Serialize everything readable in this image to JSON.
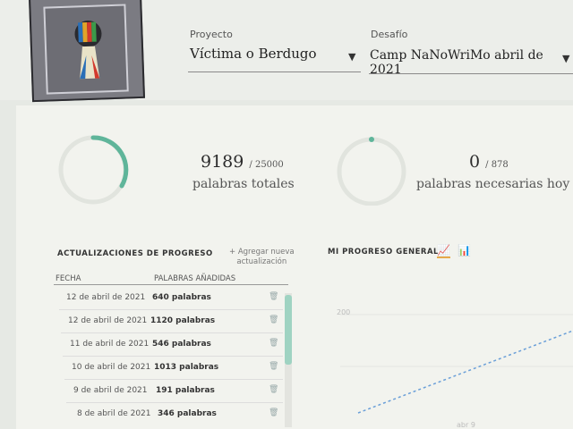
{
  "header": {
    "project_label": "Proyecto",
    "project_value": "Víctima o Berdugo",
    "challenge_label": "Desafío",
    "challenge_value": "Camp NaNoWriMo abril de 2021"
  },
  "stats": {
    "total_words": "9189",
    "total_goal": "/ 25000",
    "total_caption": "palabras totales",
    "today_words": "0",
    "today_goal": "/ 878",
    "today_caption": "palabras necesarias hoy"
  },
  "updates": {
    "title": "ACTUALIZACIONES DE PROGRESO",
    "add_link_line1": "+ Agregar nueva",
    "add_link_line2": "actualización",
    "col_date": "FECHA",
    "col_words": "PALABRAS AÑADIDAS",
    "rows": [
      {
        "date": "12 de abril de 2021",
        "words": "640 palabras"
      },
      {
        "date": "12 de abril de 2021",
        "words": "1120 palabras"
      },
      {
        "date": "11 de abril de 2021",
        "words": "546 palabras"
      },
      {
        "date": "10 de abril de 2021",
        "words": "1013 palabras"
      },
      {
        "date": "9 de abril de 2021",
        "words": "191 palabras"
      },
      {
        "date": "8 de abril de 2021",
        "words": "346 palabras"
      }
    ]
  },
  "progress_chart": {
    "title": "MI PROGRESO GENERAL",
    "icons": [
      "line-chart-icon",
      "bar-chart-icon"
    ],
    "y_tick_visible": "200",
    "x_tick_visible": "abr 9"
  },
  "colors": {
    "accent": "#5fb59a",
    "highlight": "#e7a94a"
  }
}
